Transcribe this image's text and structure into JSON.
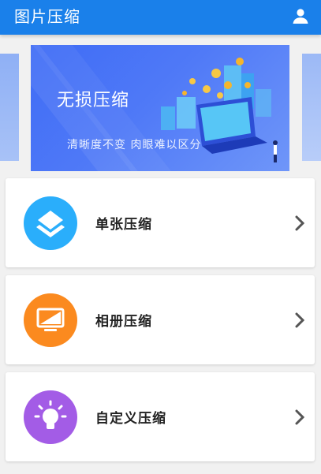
{
  "app": {
    "title": "图片压缩"
  },
  "banner": {
    "headline": "无损压缩",
    "subline": "清晰度不变 肉眼难以区分"
  },
  "options": [
    {
      "label": "单张压缩",
      "color": "#2aaefb",
      "icon": "layers-icon"
    },
    {
      "label": "相册压缩",
      "color": "#fb8a1f",
      "icon": "monitor-image-icon"
    },
    {
      "label": "自定义压缩",
      "color": "#a35ce6",
      "icon": "lightbulb-icon"
    }
  ],
  "colors": {
    "appbar": "#1a80ea",
    "banner": "#4f79f7",
    "background": "#f1f1f1"
  }
}
